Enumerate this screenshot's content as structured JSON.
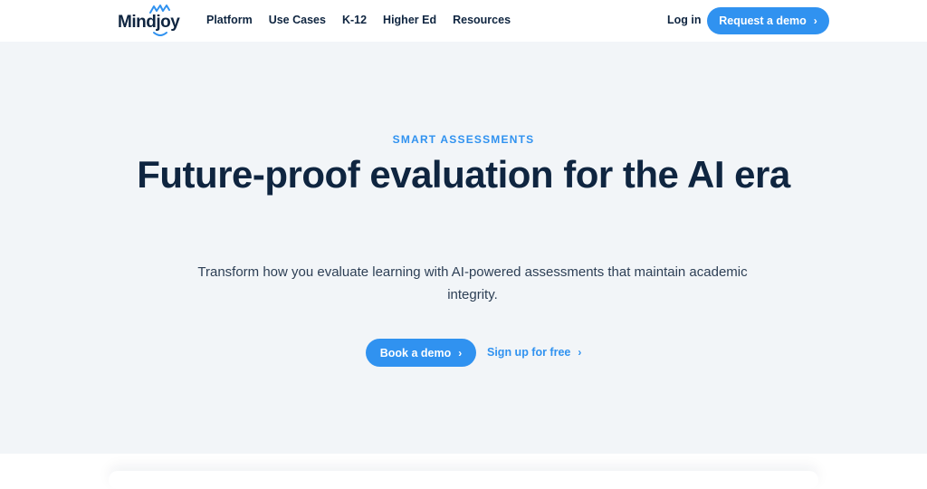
{
  "brand": {
    "name": "Mindjoy",
    "accent_color": "#3092f0",
    "text_color": "#0f2540"
  },
  "nav": {
    "links": [
      "Platform",
      "Use Cases",
      "K-12",
      "Higher Ed",
      "Resources"
    ],
    "login_label": "Log in",
    "cta_label": "Request a demo",
    "cta_icon": "chevron-right-icon"
  },
  "hero": {
    "eyebrow": "SMART ASSESSMENTS",
    "headline": "Future-proof evaluation for the AI era",
    "subtext": "Transform how you evaluate learning with AI-powered assessments that maintain academic integrity.",
    "primary_button": "Book a demo",
    "secondary_link": "Sign up for free",
    "background_color": "#f2f5f8"
  },
  "icons": {
    "chevron": "›"
  }
}
